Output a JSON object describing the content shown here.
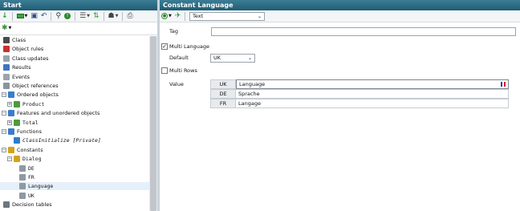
{
  "left_pane": {
    "title": "Start",
    "tree": [
      {
        "label": "Class",
        "icon": "class-icon",
        "level": 0,
        "toggle": ""
      },
      {
        "label": "Object rules",
        "icon": "object-rules-icon",
        "level": 0,
        "toggle": ""
      },
      {
        "label": "Class updates",
        "icon": "class-updates-icon",
        "level": 0,
        "toggle": ""
      },
      {
        "label": "Results",
        "icon": "results-icon",
        "level": 0,
        "toggle": ""
      },
      {
        "label": "Events",
        "icon": "events-icon",
        "level": 0,
        "toggle": ""
      },
      {
        "label": "Object references",
        "icon": "object-references-icon",
        "level": 0,
        "toggle": ""
      },
      {
        "label": "Ordered objects",
        "icon": "ordered-objects-icon",
        "level": 0,
        "toggle": "−"
      },
      {
        "label": "Product",
        "icon": "product-icon",
        "level": 1,
        "toggle": "+",
        "style": "mono"
      },
      {
        "label": "Features and unordered objects",
        "icon": "features-icon",
        "level": 0,
        "toggle": "−"
      },
      {
        "label": "Total",
        "icon": "total-icon",
        "level": 1,
        "toggle": "+",
        "style": "mono"
      },
      {
        "label": "Functions",
        "icon": "functions-icon",
        "level": 0,
        "toggle": "−"
      },
      {
        "label": "ClassInitialize [Private]",
        "icon": "function-icon",
        "level": 1,
        "toggle": "",
        "style": "mono-ital"
      },
      {
        "label": "Constants",
        "icon": "constants-icon",
        "level": 0,
        "toggle": "−"
      },
      {
        "label": "Dialog",
        "icon": "dialog-icon",
        "level": 1,
        "toggle": "−",
        "style": "mono"
      },
      {
        "label": "DE",
        "icon": "constant-icon",
        "level": 2,
        "toggle": "",
        "style": "mono"
      },
      {
        "label": "FR",
        "icon": "constant-icon",
        "level": 2,
        "toggle": "",
        "style": "mono"
      },
      {
        "label": "Language",
        "icon": "constant-icon",
        "level": 2,
        "toggle": "",
        "style": "mono",
        "selected": true
      },
      {
        "label": "UK",
        "icon": "constant-icon",
        "level": 2,
        "toggle": "",
        "style": "mono"
      },
      {
        "label": "Decision tables",
        "icon": "decision-tables-icon",
        "level": 0,
        "toggle": ""
      }
    ]
  },
  "right_pane": {
    "title": "Constant Language",
    "type_select": {
      "value": "Text"
    },
    "tag": {
      "label": "Tag",
      "value": ""
    },
    "multi_language": {
      "label": "Multi Language",
      "checked": true
    },
    "default": {
      "label": "Default",
      "value": "UK"
    },
    "multi_rows": {
      "label": "Multi Rows",
      "checked": false
    },
    "value": {
      "label": "Value",
      "rows": [
        {
          "lang": "UK",
          "text": "Language"
        },
        {
          "lang": "DE",
          "text": "Sprache"
        },
        {
          "lang": "FR",
          "text": "Langage"
        }
      ]
    }
  },
  "colors": {
    "title_bar": "#2a6b83",
    "selection": "#e6f0fa"
  }
}
